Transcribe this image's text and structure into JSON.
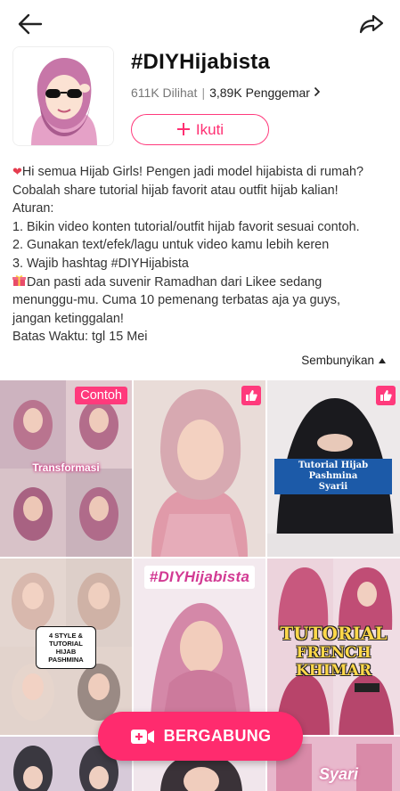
{
  "topbar": {
    "back_icon": "arrow-left-icon",
    "share_icon": "share-arrow-icon"
  },
  "header": {
    "title": "#DIYHijabista",
    "views": "611K Dilihat",
    "separator": "|",
    "fans": "3,89K Penggemar",
    "follow_label": "Ikuti",
    "follow_icon": "plus-icon"
  },
  "description": {
    "lines": [
      "Hi semua Hijab Girls! Pengen jadi model hijabista di rumah?",
      "Cobalah share tutorial hijab favorit atau outfit hijab kalian!",
      "Aturan:",
      "1. Bikin video konten tutorial/outfit hijab favorit sesuai contoh.",
      "2. Gunakan text/efek/lagu untuk video kamu lebih keren",
      "3. Wajib hashtag #DIYHijabista",
      "Dan pasti ada suvenir Ramadhan dari Likee sedang",
      "menunggu-mu. Cuma 10 pemenang terbatas aja ya guys,",
      "jangan ketinggalan!",
      "Batas Waktu: tgl 15 Mei"
    ],
    "heart_icon": "heart-icon",
    "gift_icon": "gift-icon"
  },
  "collapse": {
    "label": "Sembunyikan"
  },
  "videos": [
    {
      "badge": "Contoh",
      "caption": "Transformasi"
    },
    {
      "badge_icon": "thumbs-up-icon"
    },
    {
      "badge_icon": "thumbs-up-icon",
      "caption_line1": "Tutorial Hijab Pashmina",
      "caption_line2": "Syarii"
    },
    {
      "caption_lines": [
        "4 STYLE &",
        "TUTORIAL",
        "HIJAB",
        "PASHMINA"
      ]
    },
    {
      "caption": "#DIYHijabista"
    },
    {
      "caption_line1": "TUTORIAL",
      "caption_line2": "FRENCH KHIMAR"
    },
    {},
    {},
    {
      "caption": "Syari"
    }
  ],
  "join": {
    "label": "BERGABUNG",
    "icon": "video-camera-icon"
  },
  "colors": {
    "accent": "#ff2b6e"
  }
}
